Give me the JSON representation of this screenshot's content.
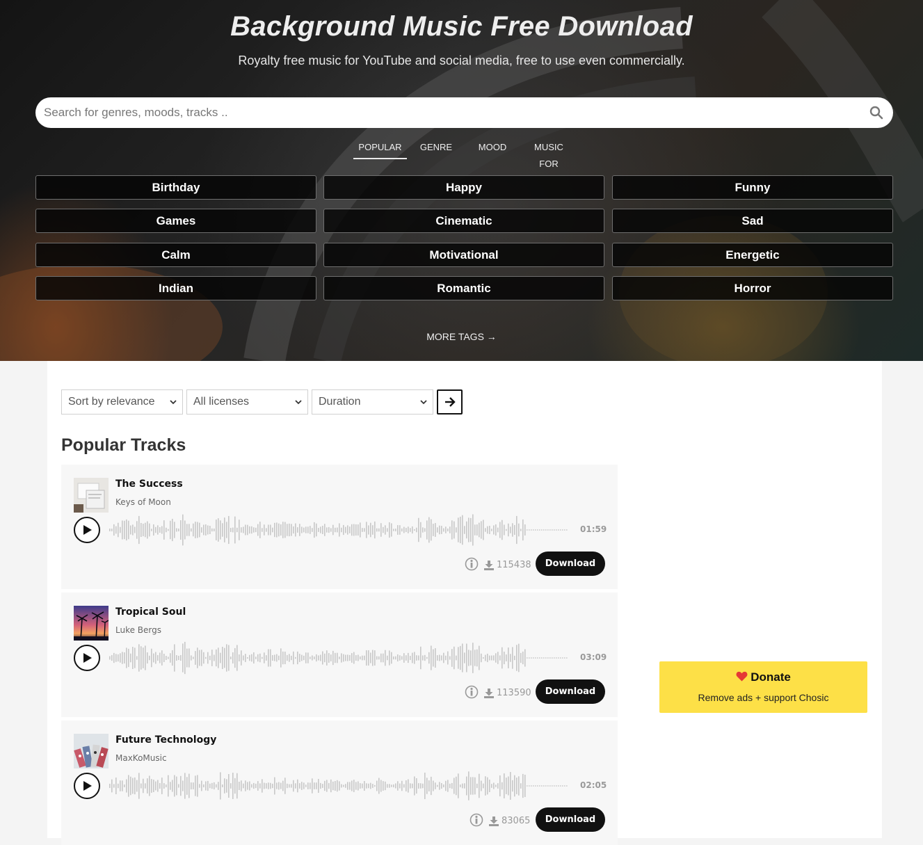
{
  "hero": {
    "title": "Background Music Free Download",
    "subtitle": "Royalty free music for YouTube and social media, free to use even commercially.",
    "search_placeholder": "Search for genres, moods, tracks .."
  },
  "tabs": [
    {
      "label": "POPULAR",
      "active": true
    },
    {
      "label": "GENRE",
      "active": false
    },
    {
      "label": "MOOD",
      "active": false
    },
    {
      "label": "MUSIC",
      "label2": "FOR",
      "active": false
    }
  ],
  "tags": [
    "Birthday",
    "Happy",
    "Funny",
    "Games",
    "Cinematic",
    "Sad",
    "Calm",
    "Motivational",
    "Energetic",
    "Indian",
    "Romantic",
    "Horror"
  ],
  "more_tags": "MORE TAGS →",
  "filters": {
    "sort": "Sort by relevance",
    "license": "All licenses",
    "duration": "Duration"
  },
  "section_title": "Popular Tracks",
  "tracks": [
    {
      "title": "The Success",
      "artist": "Keys of Moon",
      "duration": "01:59",
      "downloads": "115438",
      "download_label": "Download"
    },
    {
      "title": "Tropical Soul",
      "artist": "Luke Bergs",
      "duration": "03:09",
      "downloads": "113590",
      "download_label": "Download"
    },
    {
      "title": "Future Technology",
      "artist": "MaxKoMusic",
      "duration": "02:05",
      "downloads": "83065",
      "download_label": "Download"
    }
  ],
  "donate": {
    "label": "Donate",
    "sub": "Remove ads + support Chosic",
    "heart_color": "#e53935"
  },
  "colors": {
    "button_dark": "#111111",
    "donate_bg": "#fde047",
    "waveform": "#c8c8c8"
  }
}
